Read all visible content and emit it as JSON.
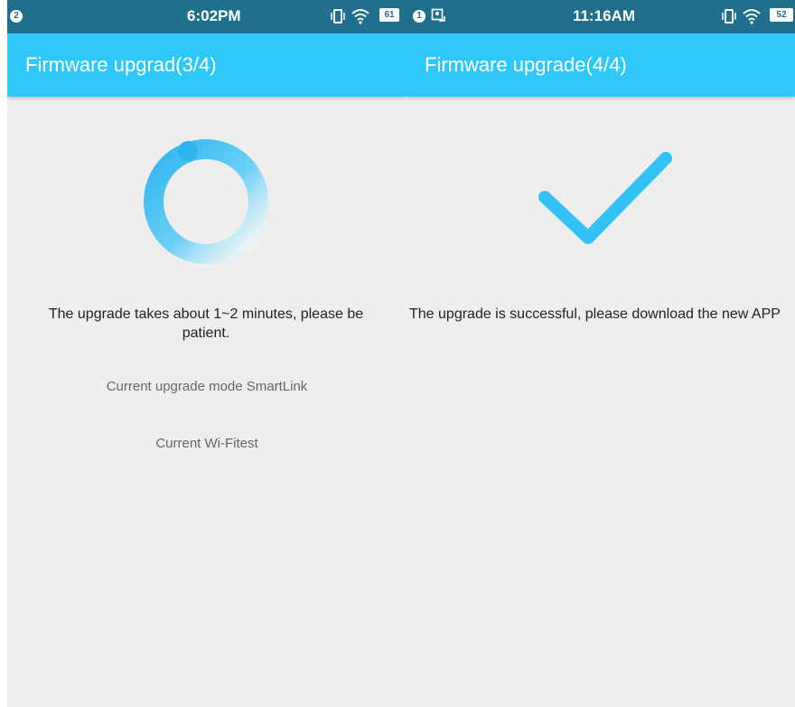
{
  "left_screen": {
    "status": {
      "notification_count": "2",
      "time": "6:02PM",
      "battery": "61"
    },
    "title": "Firmware upgrad(3/4)",
    "message": "The upgrade takes about 1~2 minutes, please be patient.",
    "mode_text": "Current upgrade mode SmartLink",
    "wifi_text": "Current Wi-Fitest"
  },
  "right_screen": {
    "status": {
      "notification_count": "1",
      "time": "11:16AM",
      "battery": "52"
    },
    "title": "Firmware upgrade(4/4)",
    "message": "The upgrade is successful, please download the new APP"
  },
  "colors": {
    "statusbar": "#1f6f8d",
    "appbar": "#2ec8fb",
    "background": "#eeeeee",
    "accent": "#33c2f5"
  },
  "icons": [
    "vibrate-icon",
    "wifi-icon",
    "battery-icon",
    "loading-spinner-icon",
    "checkmark-icon",
    "screenshot-icon"
  ]
}
